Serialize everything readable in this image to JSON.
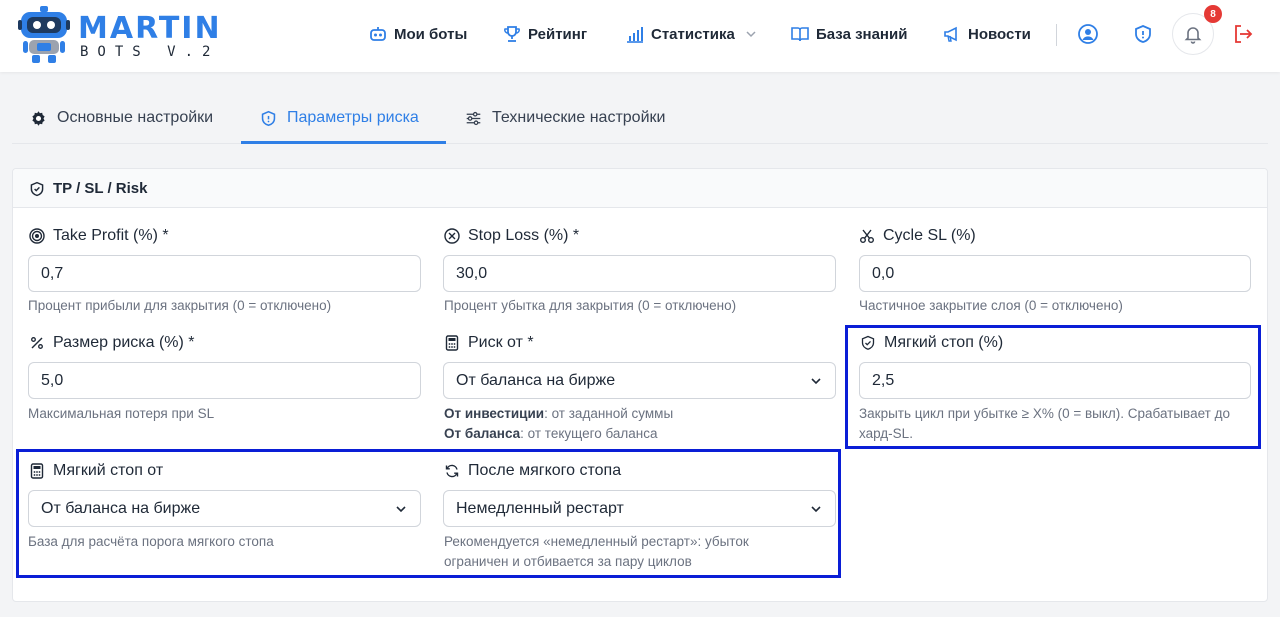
{
  "logo": {
    "title": "MARTIN",
    "subtitle": "BOTS V.2"
  },
  "nav": {
    "my_bots": "Мои боты",
    "rating": "Рейтинг",
    "statistics": "Статистика",
    "knowledge": "База знаний",
    "news": "Новости",
    "notifications_count": "8"
  },
  "tabs": [
    {
      "label": "Основные настройки",
      "icon": "gear-icon"
    },
    {
      "label": "Параметры риска",
      "icon": "shield-icon",
      "active": true
    },
    {
      "label": "Технические настройки",
      "icon": "sliders-icon"
    }
  ],
  "card": {
    "title": "TP / SL / Risk",
    "fields": {
      "take_profit": {
        "label": "Take Profit (%) *",
        "value": "0,7",
        "help": "Процент прибыли для закрытия (0 = отключено)"
      },
      "stop_loss": {
        "label": "Stop Loss (%) *",
        "value": "30,0",
        "help": "Процент убытка для закрытия (0 = отключено)"
      },
      "cycle_sl": {
        "label": "Cycle SL (%)",
        "value": "0,0",
        "help": "Частичное закрытие слоя (0 = отключено)"
      },
      "risk_size": {
        "label": "Размер риска (%) *",
        "value": "5,0",
        "help": "Максимальная потеря при SL"
      },
      "risk_from": {
        "label": "Риск от *",
        "value": "От баланса на бирже",
        "help_line1_bold": "От инвестиции",
        "help_line1": ": от заданной суммы",
        "help_line2_bold": "От баланса",
        "help_line2": ": от текущего баланса"
      },
      "soft_stop": {
        "label": "Мягкий стоп (%)",
        "value": "2,5",
        "help": "Закрыть цикл при убытке ≥ X% (0 = выкл). Срабатывает до хард-SL."
      },
      "soft_stop_from": {
        "label": "Мягкий стоп от",
        "value": "От баланса на бирже",
        "help": "База для расчёта порога мягкого стопа"
      },
      "after_soft_stop": {
        "label": "После мягкого стопа",
        "value": "Немедленный рестарт",
        "help": "Рекомендуется «немедленный рестарт»: убыток ограничен и отбивается за пару циклов"
      }
    }
  },
  "colors": {
    "accent": "#2f7fe6",
    "highlight": "#0a1ed6",
    "badge": "#e53935",
    "logout": "#e53935"
  }
}
